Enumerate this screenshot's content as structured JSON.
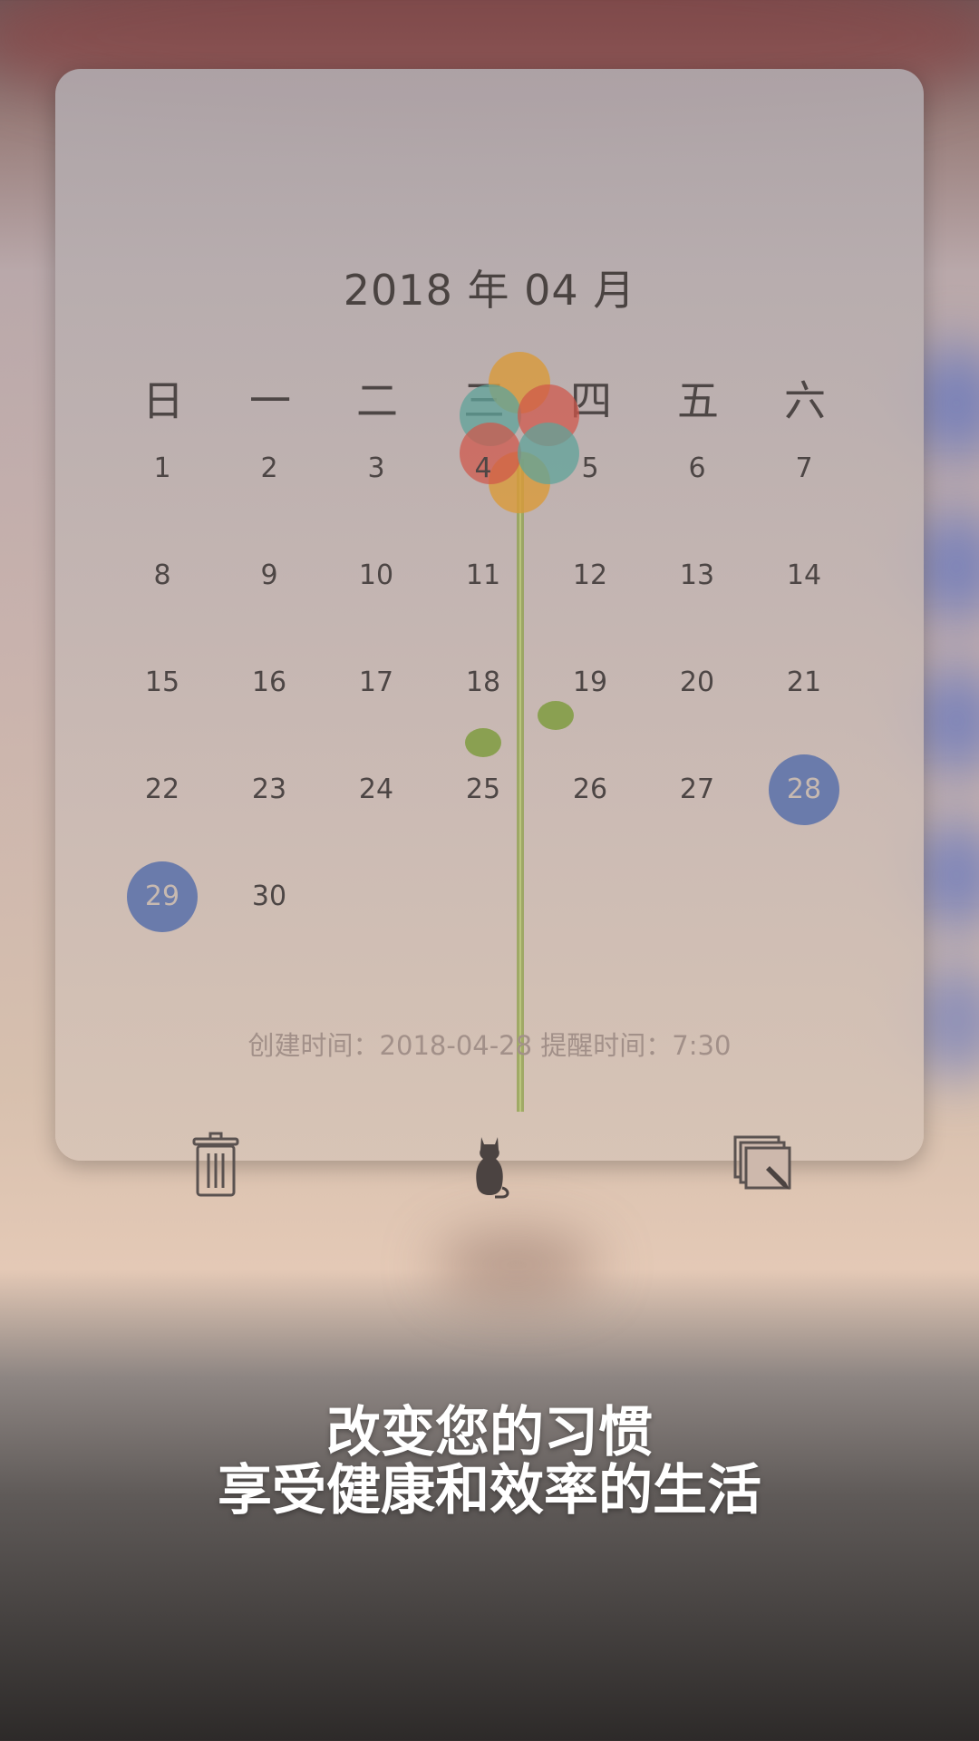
{
  "calendar": {
    "month_title": "2018 年 04 月",
    "weekdays": [
      "日",
      "一",
      "二",
      "三",
      "四",
      "五",
      "六"
    ],
    "weeks": [
      [
        "",
        "",
        "",
        "",
        "",
        "",
        ""
      ],
      [
        "1",
        "2",
        "3",
        "4",
        "5",
        "6",
        "7"
      ],
      [
        "8",
        "9",
        "10",
        "11",
        "12",
        "13",
        "14"
      ],
      [
        "15",
        "16",
        "17",
        "18",
        "19",
        "20",
        "21"
      ],
      [
        "22",
        "23",
        "24",
        "25",
        "26",
        "27",
        "28"
      ],
      [
        "29",
        "30",
        "",
        "",
        "",
        "",
        ""
      ]
    ],
    "selected_days": [
      "28",
      "29"
    ],
    "info_text": "创建时间：2018-04-28  提醒时间：7:30"
  },
  "toolbar": {
    "delete_icon": "trash-icon",
    "center_icon": "cat-icon",
    "edit_icon": "notes-edit-icon"
  },
  "tagline": {
    "line1": "改变您的习惯",
    "line2": "享受健康和效率的生活"
  },
  "colors": {
    "selected_circle": "#6a7bab",
    "text": "#4d4645",
    "info_text": "#a29089"
  }
}
